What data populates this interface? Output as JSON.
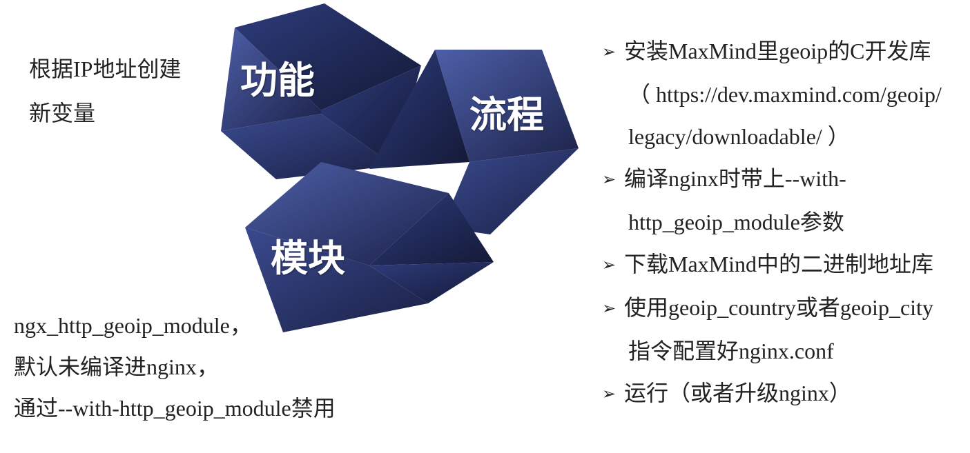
{
  "cubes": {
    "function_label": "功能",
    "process_label": "流程",
    "module_label": "模块"
  },
  "function_text": [
    "根据IP地址创建",
    "新变量"
  ],
  "module_text": [
    "ngx_http_geoip_module，",
    "默认未编译进nginx，",
    "通过--with-http_geoip_module禁用"
  ],
  "process_lines": [
    {
      "bullet": true,
      "text": "安装MaxMind里geoip的C开发库"
    },
    {
      "bullet": false,
      "text": "（ https://dev.maxmind.com/geoip/"
    },
    {
      "bullet": false,
      "text": "legacy/downloadable/ ）"
    },
    {
      "bullet": true,
      "text": "编译nginx时带上--with-"
    },
    {
      "bullet": false,
      "text": "http_geoip_module参数"
    },
    {
      "bullet": true,
      "text": "下载MaxMind中的二进制地址库"
    },
    {
      "bullet": true,
      "text": "使用geoip_country或者geoip_city"
    },
    {
      "bullet": false,
      "text": "指令配置好nginx.conf"
    },
    {
      "bullet": true,
      "text": "运行（或者升级nginx）"
    }
  ],
  "bullet_icon": "arrow-right-icon",
  "colors": {
    "cube_dark": "#1b2147",
    "cube_mid": "#2b3a78",
    "cube_light": "#4a5ea8",
    "text": "#222222"
  }
}
